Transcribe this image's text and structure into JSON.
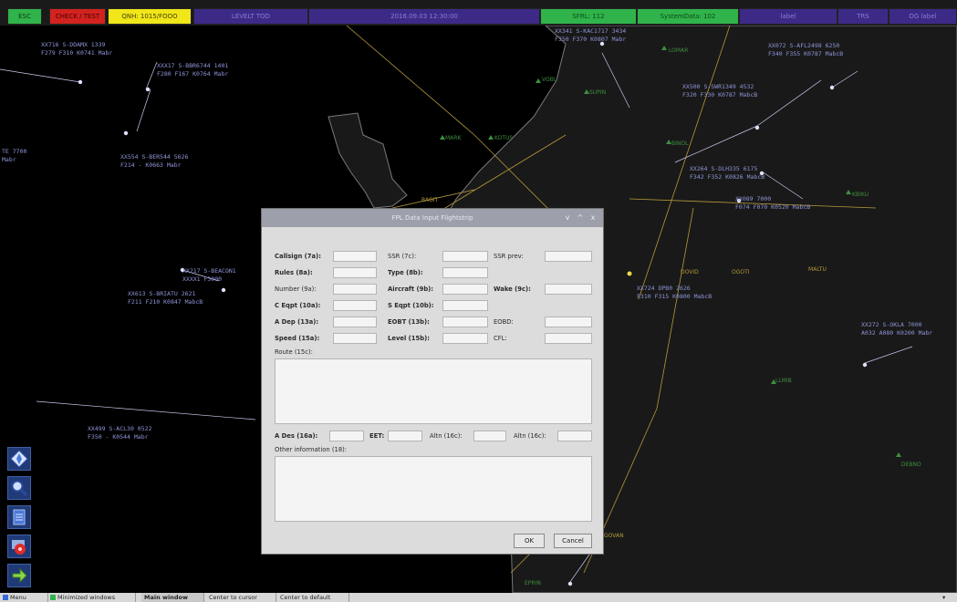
{
  "topbar": {
    "items": [
      {
        "label": "ESC"
      },
      {
        "label": "CHECK / TEST"
      },
      {
        "label": "QNH: 1015/FOOO"
      },
      {
        "label": "LEVELT TOD"
      },
      {
        "label": "2016.09.03 12:30:00"
      },
      {
        "label": "SFRL: 112"
      },
      {
        "label": "SystemData: 102"
      },
      {
        "label": "label"
      },
      {
        "label": "TRS"
      },
      {
        "label": "DG label"
      }
    ]
  },
  "radar": {
    "tracks": [
      {
        "l1": "XX716 S-DDAMX 1339",
        "l2": "F279 F310 K0741 Mabr"
      },
      {
        "l1": "XXX17 S-BBR6744 1401",
        "l2": "F280 F167 K0764 Mabr"
      },
      {
        "l1": "XX341 S-KAC1717 3434",
        "l2": "F350 F370 K0807 Mabr"
      },
      {
        "l1": "XX072 S-AFL2498 6250",
        "l2": "F340 F355 K0787 MabcB"
      },
      {
        "l1": "XX500 S-SWR1349 4532",
        "l2": "F320 F330 K0787 MabcB"
      },
      {
        "l1": "XX554 S-BER544 5626",
        "l2": "F214 - K0663 Mabr"
      },
      {
        "l1": "XX264 S-DLH335 6175",
        "l2": "F342 F352 K0826 MabcB"
      },
      {
        "l1": "XX089 7000",
        "l2": "F074 F070 K0520 MabcB"
      },
      {
        "l1": "XX217 S-BEACON1",
        "l2": "XXXX1 F3000"
      },
      {
        "l1": "XX613 S-BRIATU 2621",
        "l2": "F211 F210 K0847 MabcB"
      },
      {
        "l1": "XX724 DPB0 2626",
        "l2": "F310 F315 K0800 MabcB"
      },
      {
        "l1": "XX272 S-OKLA 7000",
        "l2": "A032 A080 K0200 Mabr"
      },
      {
        "l1": "XX499 S-ACL30 0522",
        "l2": "F350 - K0544 Mabr"
      },
      {
        "l1": "TE 7700",
        "l2": "Mabr"
      }
    ],
    "fixes": [
      "LOMAR",
      "VOBL",
      "SUPIN",
      "BINOL",
      "KOTUS",
      "MARK",
      "BAGIT",
      "KBIKU",
      "DOVID",
      "OGOTI",
      "MALTU",
      "LLMIB",
      "DEBNO",
      "GOVAN",
      "EPRIN"
    ]
  },
  "dialog": {
    "title": "FPL Data Input Flightstrip",
    "titlebar_buttons": [
      "v",
      "^",
      "x"
    ],
    "fields": {
      "callsign": "Callsign (7a):",
      "ssr": "SSR (7c):",
      "ssr_prev": "SSR prev:",
      "rules": "Rules (8a):",
      "type": "Type (8b):",
      "number": "Number (9a):",
      "aircraft": "Aircraft (9b):",
      "wake": "Wake (9c):",
      "c_eqpt": "C Eqpt (10a):",
      "s_eqpt": "S Eqpt (10b):",
      "a_dep": "A Dep (13a):",
      "eobt": "EOBT (13b):",
      "eobd": "EOBD:",
      "speed": "Speed (15a):",
      "level": "Level (15b):",
      "cfl": "CFL:",
      "route": "Route (15c):",
      "a_des": "A Des (16a):",
      "eet": "EET:",
      "altn1": "Altn (16c):",
      "altn2": "Altn (16c):",
      "other": "Other information (18):"
    },
    "buttons": {
      "ok": "OK",
      "cancel": "Cancel"
    }
  },
  "toolbox": {
    "icons": [
      "compass-icon",
      "magnifier-icon",
      "document-icon",
      "settings-icon",
      "arrow-icon"
    ]
  },
  "statusbar": {
    "items": [
      "Menu",
      "Minimized windows",
      "Main window",
      "Center to cursor",
      "Center to default"
    ]
  },
  "colors": {
    "topbar_green": "#2fb34a",
    "topbar_red": "#d2231f",
    "topbar_yellow": "#f0e61a",
    "topbar_purple": "#3d2a87",
    "map_land": "#191919",
    "track_label": "#8e95d8",
    "airway": "#b49a3a",
    "dialog_bg": "#dcdcdc"
  }
}
